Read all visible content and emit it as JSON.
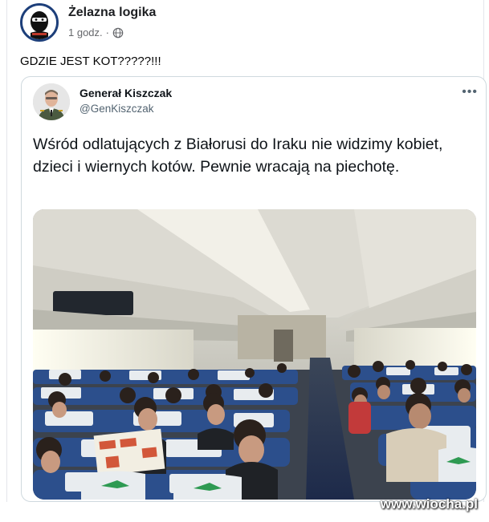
{
  "post": {
    "page_name": "Żelazna logika",
    "time": "1 godz.",
    "separator": "·",
    "privacy_icon": "globe-icon",
    "text": "GDZIE JEST KOT?????!!!"
  },
  "tweet": {
    "author_name": "Generał Kiszczak",
    "author_handle": "@GenKiszczak",
    "more_label": "•••",
    "text": "Wśród odlatujących z Białorusi do Iraku nie widzimy kobiet, dzieci i wiernych kotów. Pewnie wracają na piechotę."
  },
  "watermark": "www.wiocha.pl",
  "colors": {
    "link_blue": "#1877f2",
    "seat_blue": "#2c4f8c",
    "seat_white": "#e8ecef",
    "cabin_wall": "#d9d9cf"
  }
}
